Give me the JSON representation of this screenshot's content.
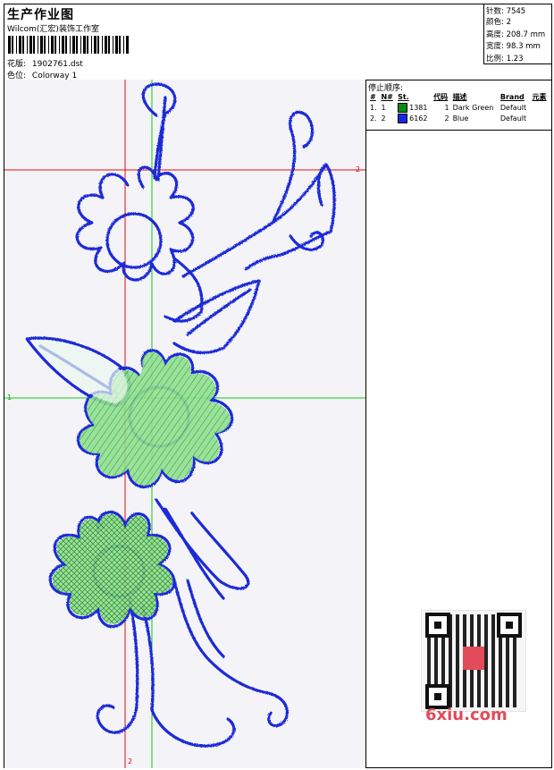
{
  "header": {
    "title": "生产作业图",
    "subtitle": "Wilcom(汇宏)装饰工作室",
    "design_label": "花版:",
    "design_file": "1902761.dst",
    "colorway_label": "色位:",
    "colorway": "Colorway 1"
  },
  "stats": {
    "stitches_label": "针数:",
    "stitches": "7545",
    "colors_label": "颜色:",
    "colors": "2",
    "height_label": "高度:",
    "height": "208.7 mm",
    "width_label": "宽度:",
    "width": "98.3 mm",
    "scale_label": "比例:",
    "scale": "1.23"
  },
  "guides": {
    "h_top": "2",
    "h_mid": "1",
    "v_bottom": "2"
  },
  "stop_sequence": {
    "title": "停止顺序:",
    "columns": [
      "#",
      "N#",
      "St.",
      "代码",
      "描述",
      "Brand",
      "元素"
    ],
    "rows": [
      {
        "idx": "1.",
        "n": "1",
        "st": "1381",
        "code": "1",
        "desc": "Dark Green",
        "brand": "Default",
        "color": "#0a8a16"
      },
      {
        "idx": "2.",
        "n": "2",
        "st": "6162",
        "code": "2",
        "desc": "Blue",
        "brand": "Default",
        "color": "#1428e0"
      }
    ]
  },
  "watermark": "6xiu.com",
  "colors": {
    "thread_blue": "#1a2ad6",
    "fill_green": "#7cd87c",
    "guide_red": "#e01010",
    "guide_green": "#11cc11"
  }
}
